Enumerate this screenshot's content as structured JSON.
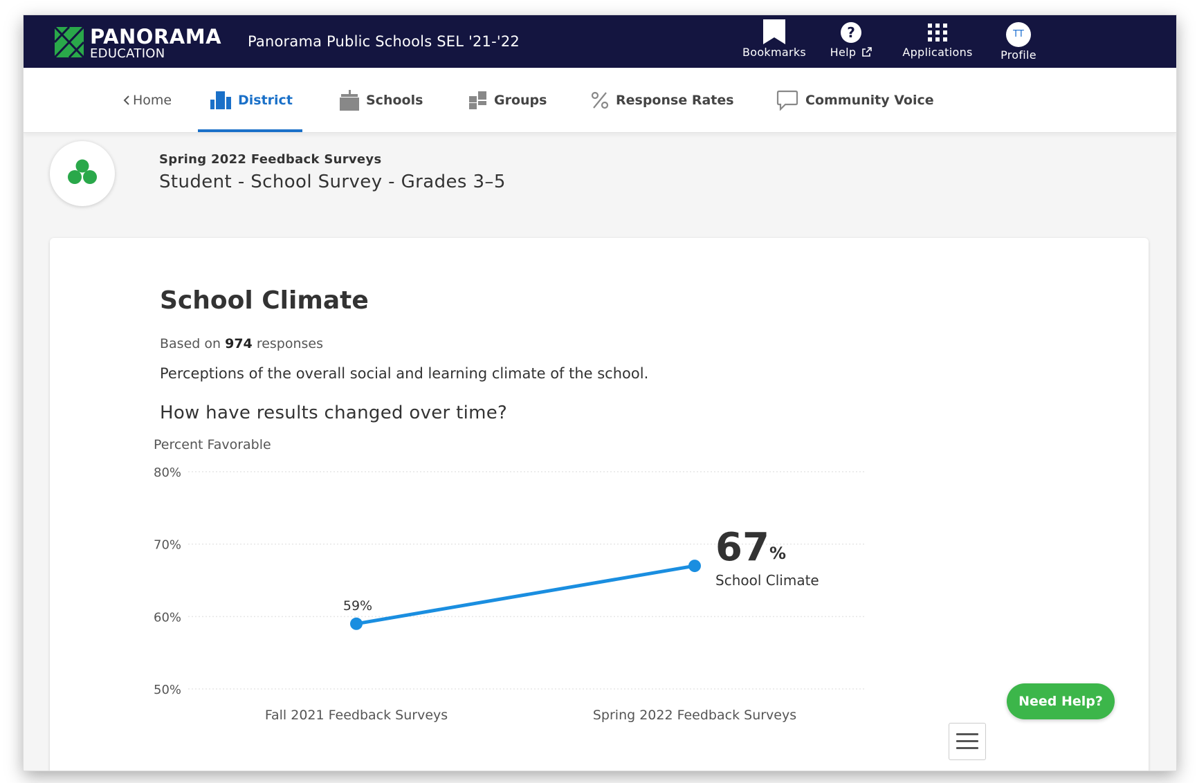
{
  "header": {
    "brand": "PANORAMA",
    "brand_sub": "EDUCATION",
    "app_title": "Panorama Public Schools SEL '21-'22",
    "nav": {
      "bookmarks": "Bookmarks",
      "help": "Help",
      "applications": "Applications",
      "profile": "Profile",
      "avatar_initials": "TT"
    }
  },
  "subnav": {
    "home": "Home",
    "tabs": [
      "District",
      "Schools",
      "Groups",
      "Response Rates",
      "Community Voice"
    ],
    "active_tab": "District"
  },
  "survey": {
    "name": "Spring 2022 Feedback Surveys",
    "title": "Student - School Survey - Grades 3–5"
  },
  "card": {
    "title": "School Climate",
    "responses_prefix": "Based on",
    "responses_count": "974",
    "responses_suffix": "responses",
    "description": "Perceptions of the overall social and learning climate of the school.",
    "question": "How have results changed over time?"
  },
  "chart_data": {
    "type": "line",
    "ylabel": "Percent Favorable",
    "categories": [
      "Fall 2021 Feedback Surveys",
      "Spring 2022 Feedback Surveys"
    ],
    "y_ticks": [
      "80%",
      "70%",
      "60%",
      "50%"
    ],
    "ylim": [
      50,
      80
    ],
    "series": [
      {
        "name": "School Climate",
        "values": [
          59,
          67
        ]
      }
    ],
    "point_labels": [
      "59%"
    ],
    "callout": {
      "value": "67",
      "unit": "%",
      "label": "School Climate"
    },
    "line_color": "#1a8ee0",
    "grid": true
  },
  "help_button": "Need Help?",
  "colors": {
    "topbar": "#141540",
    "accent": "#1a70c8",
    "brand_green": "#2aa84a",
    "help_green": "#3cb64a"
  }
}
